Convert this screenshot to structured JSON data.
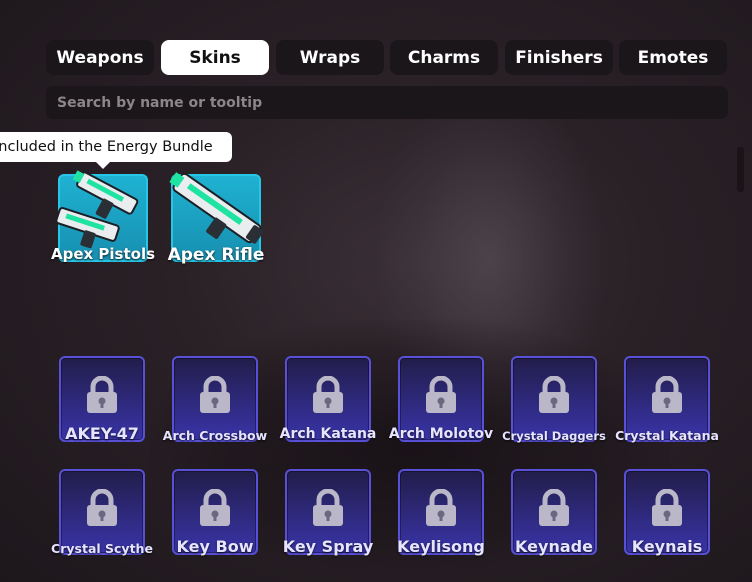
{
  "tabs": [
    {
      "label": "Weapons",
      "active": false
    },
    {
      "label": "Skins",
      "active": true
    },
    {
      "label": "Wraps",
      "active": false
    },
    {
      "label": "Charms",
      "active": false
    },
    {
      "label": "Finishers",
      "active": false
    },
    {
      "label": "Emotes",
      "active": false
    }
  ],
  "search": {
    "placeholder": "Search by name or tooltip",
    "value": ""
  },
  "tooltip": {
    "text": "Included in the Energy Bundle"
  },
  "owned_items": [
    {
      "name": "Apex Pistols",
      "icon": "dual-pistols-icon"
    },
    {
      "name": "Apex Rifle",
      "icon": "rifle-icon"
    }
  ],
  "locked_items": [
    {
      "name": "AKEY-47"
    },
    {
      "name": "Arch Crossbow"
    },
    {
      "name": "Arch Katana"
    },
    {
      "name": "Arch Molotov"
    },
    {
      "name": "Crystal Daggers"
    },
    {
      "name": "Crystal Katana"
    },
    {
      "name": "Crystal Scythe"
    },
    {
      "name": "Key Bow"
    },
    {
      "name": "Key Spray"
    },
    {
      "name": "Keylisong"
    },
    {
      "name": "Keynade"
    },
    {
      "name": "Keynais"
    }
  ],
  "colors": {
    "tab_bg": "#1b1619",
    "tab_active_bg": "#ffffff",
    "owned_card": "#1fb2d2",
    "locked_card": "#3934a8",
    "locked_border": "#5850d6"
  }
}
